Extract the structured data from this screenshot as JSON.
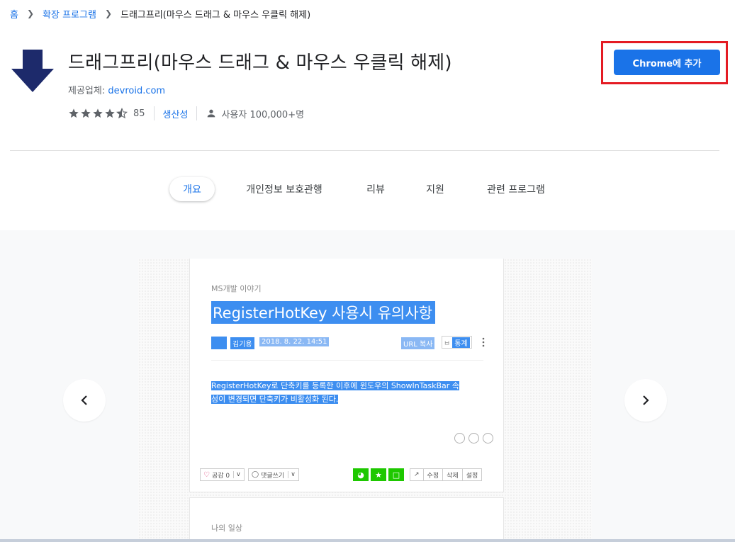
{
  "breadcrumb": {
    "home": "홈",
    "category": "확장 프로그램",
    "current": "드래그프리(마우스 드래그 & 마우스 우클릭 해제)"
  },
  "extension": {
    "title": "드래그프리(마우스 드래그 & 마우스 우클릭 해제)",
    "provider_label": "제공업체:",
    "provider": "devroid.com",
    "rating": 4.5,
    "rating_count": "85",
    "category": "생산성",
    "users": "사용자 100,000+명",
    "icon": "arrow-down-icon"
  },
  "add_button": {
    "label": "Chrome에 추가"
  },
  "tabs": [
    {
      "label": "개요",
      "active": true
    },
    {
      "label": "개인정보 보호관행",
      "active": false
    },
    {
      "label": "리뷰",
      "active": false
    },
    {
      "label": "지원",
      "active": false
    },
    {
      "label": "관련 프로그램",
      "active": false
    }
  ],
  "screenshot": {
    "category": "MS개발 이야기",
    "title": "RegisterHotKey 사용시 유의사항",
    "author": "김기용",
    "date": "2018. 8. 22. 14:51",
    "url_copy": "URL 복사",
    "stats_prefix": "ㅂ",
    "stats": "통계",
    "body_line1": "RegisterHotKey로 단축키를 등록한 이후에 윈도우의 ShowInTaskBar 속",
    "body_line2": "성이 변경되면 단축키가 비활성화 된다.",
    "like": "공감 0",
    "comment": "댓글쓰기",
    "edit": "수정",
    "delete": "삭제",
    "settings": "설정",
    "next_category": "나의 일상"
  },
  "colors": {
    "accent": "#1a73e8",
    "highlight_box": "#e41b23",
    "icon_navy": "#1d2a6b"
  }
}
